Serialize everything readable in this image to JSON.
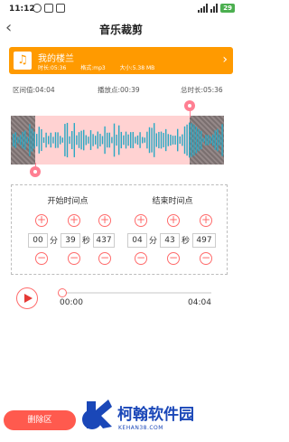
{
  "status_bar": {
    "time": "11:12",
    "battery": "29"
  },
  "header": {
    "title": "音乐裁剪",
    "back_icon": "back-arrow-icon"
  },
  "song": {
    "name": "我的楼兰",
    "duration": "时长:05:36",
    "format": "格式:mp3",
    "size": "大小:5.38 MB",
    "icon": "music-note-icon"
  },
  "info": {
    "interval": "区间值:04:04",
    "playback": "播放点:00:39",
    "total": "总时长:05:36"
  },
  "selection": {
    "start_fraction": 0.116,
    "end_fraction": 0.841
  },
  "start_time": {
    "title": "开始时间点",
    "minutes": "00",
    "min_unit": "分",
    "seconds": "39",
    "sec_unit": "秒",
    "millis": "437"
  },
  "end_time": {
    "title": "结束时间点",
    "minutes": "04",
    "min_unit": "分",
    "seconds": "43",
    "sec_unit": "秒",
    "millis": "497"
  },
  "player": {
    "current": "00:00",
    "duration": "04:04",
    "progress": 0.0
  },
  "bottom": {
    "delete_label": "删除区"
  },
  "watermark": {
    "name": "柯翰软件园",
    "url": "KEHAN38.COM"
  },
  "colors": {
    "accent": "#ff6b6b",
    "card": "#ff9a00",
    "wave": "#2aa8c4",
    "selection": "#ffd2d2"
  }
}
